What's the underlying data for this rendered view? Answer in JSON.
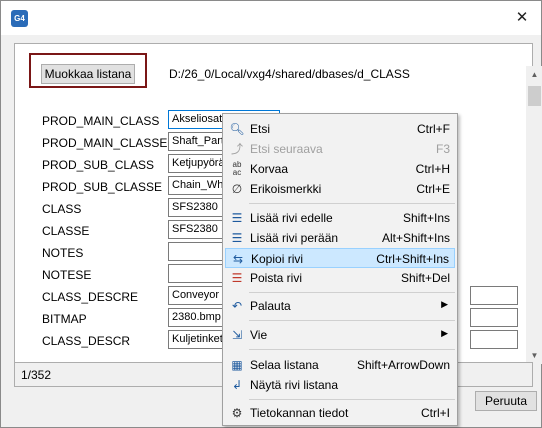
{
  "window": {
    "app_icon_text": "G4",
    "close_glyph": "✕"
  },
  "toolbar": {
    "edit_list_label": "Muokkaa listana",
    "path": "D:/26_0/Local/vxg4/shared/dbases/d_CLASS"
  },
  "fields": [
    {
      "label": "PROD_MAIN_CLASS",
      "value": "Akseliosat"
    },
    {
      "label": "PROD_MAIN_CLASSE",
      "value": "Shaft_Parts"
    },
    {
      "label": "PROD_SUB_CLASS",
      "value": "Ketjupyörät"
    },
    {
      "label": "PROD_SUB_CLASSE",
      "value": "Chain_Wheels"
    },
    {
      "label": "CLASS",
      "value": "SFS2380"
    },
    {
      "label": "CLASSE",
      "value": "SFS2380"
    },
    {
      "label": "NOTES",
      "value": ""
    },
    {
      "label": "NOTESE",
      "value": ""
    },
    {
      "label": "CLASS_DESCRE",
      "value": "Conveyor cha"
    },
    {
      "label": "BITMAP",
      "value": "2380.bmp"
    },
    {
      "label": "CLASS_DESCR",
      "value": "Kuljetinketjupy"
    }
  ],
  "status": {
    "record": "1/352"
  },
  "footer": {
    "cancel_label": "Peruuta"
  },
  "context_menu": {
    "items": [
      {
        "label": "Etsi",
        "shortcut": "Ctrl+F",
        "icon": "search-icon"
      },
      {
        "label": "Etsi seuraava",
        "shortcut": "F3",
        "icon": "find-next-icon",
        "disabled": true
      },
      {
        "label": "Korvaa",
        "shortcut": "Ctrl+H",
        "icon": "replace-icon"
      },
      {
        "label": "Erikoismerkki",
        "shortcut": "Ctrl+E",
        "icon": "special-char-icon"
      },
      {
        "label": "Lisää rivi edelle",
        "shortcut": "Shift+Ins",
        "icon": "insert-row-before-icon"
      },
      {
        "label": "Lisää rivi perään",
        "shortcut": "Alt+Shift+Ins",
        "icon": "insert-row-after-icon"
      },
      {
        "label": "Kopioi rivi",
        "shortcut": "Ctrl+Shift+Ins",
        "icon": "copy-row-icon",
        "hovered": true
      },
      {
        "label": "Poista rivi",
        "shortcut": "Shift+Del",
        "icon": "delete-row-icon"
      },
      {
        "label": "Palauta",
        "shortcut": "",
        "icon": "undo-icon",
        "submenu": true
      },
      {
        "label": "Vie",
        "shortcut": "",
        "icon": "export-icon",
        "submenu": true
      },
      {
        "label": "Selaa listana",
        "shortcut": "Shift+ArrowDown",
        "icon": "browse-list-icon"
      },
      {
        "label": "Näytä rivi listana",
        "shortcut": "",
        "icon": "show-row-list-icon"
      },
      {
        "label": "Tietokannan tiedot",
        "shortcut": "Ctrl+I",
        "icon": "database-info-icon"
      }
    ]
  },
  "colors": {
    "hover_bg": "#cce8ff",
    "accent_frame": "#7a1616",
    "icon_blue": "#1e5a9e"
  }
}
